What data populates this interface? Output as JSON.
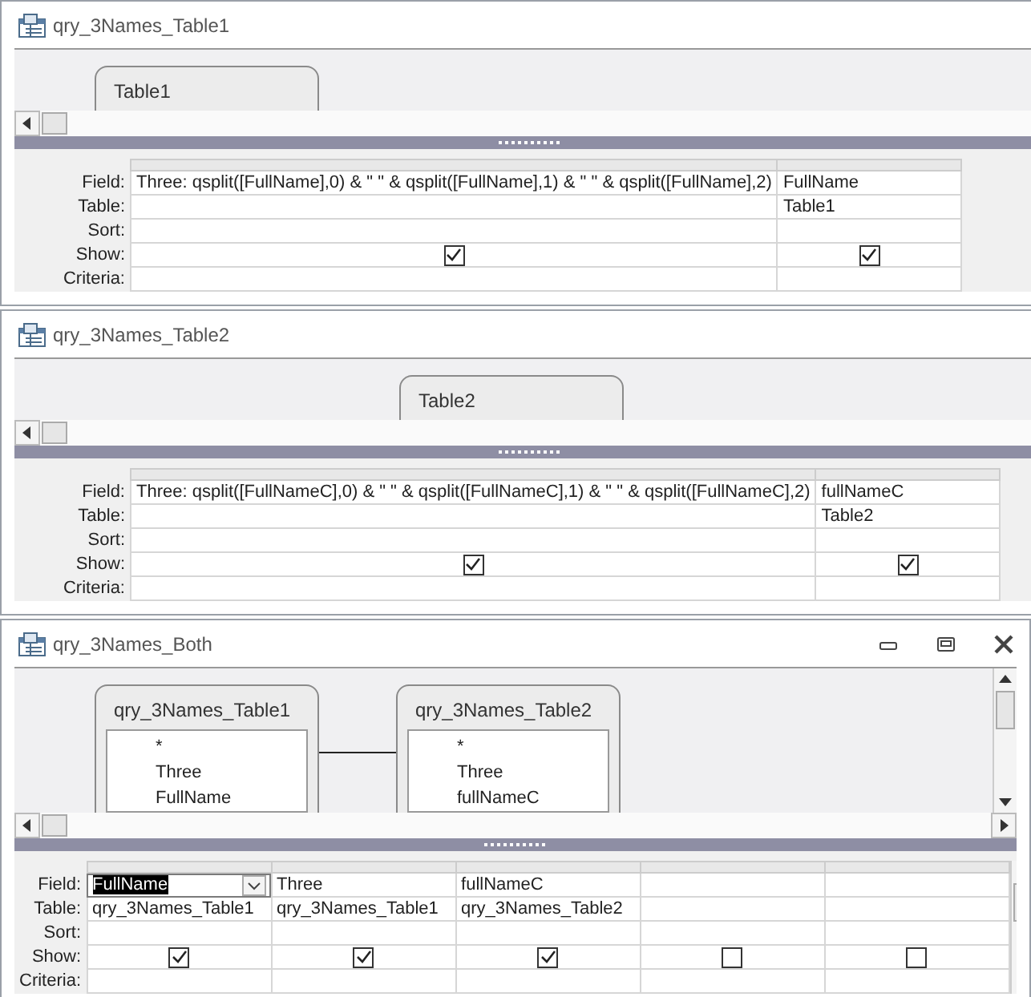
{
  "windows": [
    {
      "title": "qry_3Names_Table1",
      "controls": false,
      "tables": [
        {
          "name": "Table1"
        }
      ],
      "row_labels": [
        "Field:",
        "Table:",
        "Sort:",
        "Show:",
        "Criteria:"
      ],
      "columns": [
        {
          "field": "Three: qsplit([FullName],0) & \" \" & qsplit([FullName],1) & \" \" & qsplit([FullName],2)",
          "show": true,
          "selected": false
        },
        {
          "field": "FullName",
          "table": "Table1",
          "show": true,
          "selected": false
        }
      ]
    },
    {
      "title": "qry_3Names_Table2",
      "controls": false,
      "tables": [
        {
          "name": "Table2"
        }
      ],
      "row_labels": [
        "Field:",
        "Table:",
        "Sort:",
        "Show:",
        "Criteria:"
      ],
      "columns": [
        {
          "field": "Three: qsplit([FullNameC],0) & \" \" & qsplit([FullNameC],1) & \" \" & qsplit([FullNameC],2)",
          "show": true,
          "selected": false
        },
        {
          "field": "fullNameC",
          "table": "Table2",
          "show": true,
          "selected": false
        }
      ]
    },
    {
      "title": "qry_3Names_Both",
      "controls": true,
      "joined": true,
      "tables": [
        {
          "name": "qry_3Names_Table1",
          "fields": [
            "*",
            "Three",
            "FullName"
          ]
        },
        {
          "name": "qry_3Names_Table2",
          "fields": [
            "*",
            "Three",
            "fullNameC"
          ]
        }
      ],
      "row_labels": [
        "Field:",
        "Table:",
        "Sort:",
        "Show:",
        "Criteria:"
      ],
      "columns": [
        {
          "field": "FullName",
          "table": "qry_3Names_Table1",
          "show": true,
          "selected": true
        },
        {
          "field": "Three",
          "table": "qry_3Names_Table1",
          "show": true,
          "selected": false
        },
        {
          "field": "fullNameC",
          "table": "qry_3Names_Table2",
          "show": true,
          "selected": false
        },
        {
          "show": false,
          "selected": false
        },
        {
          "show": false,
          "selected": false
        }
      ]
    }
  ]
}
